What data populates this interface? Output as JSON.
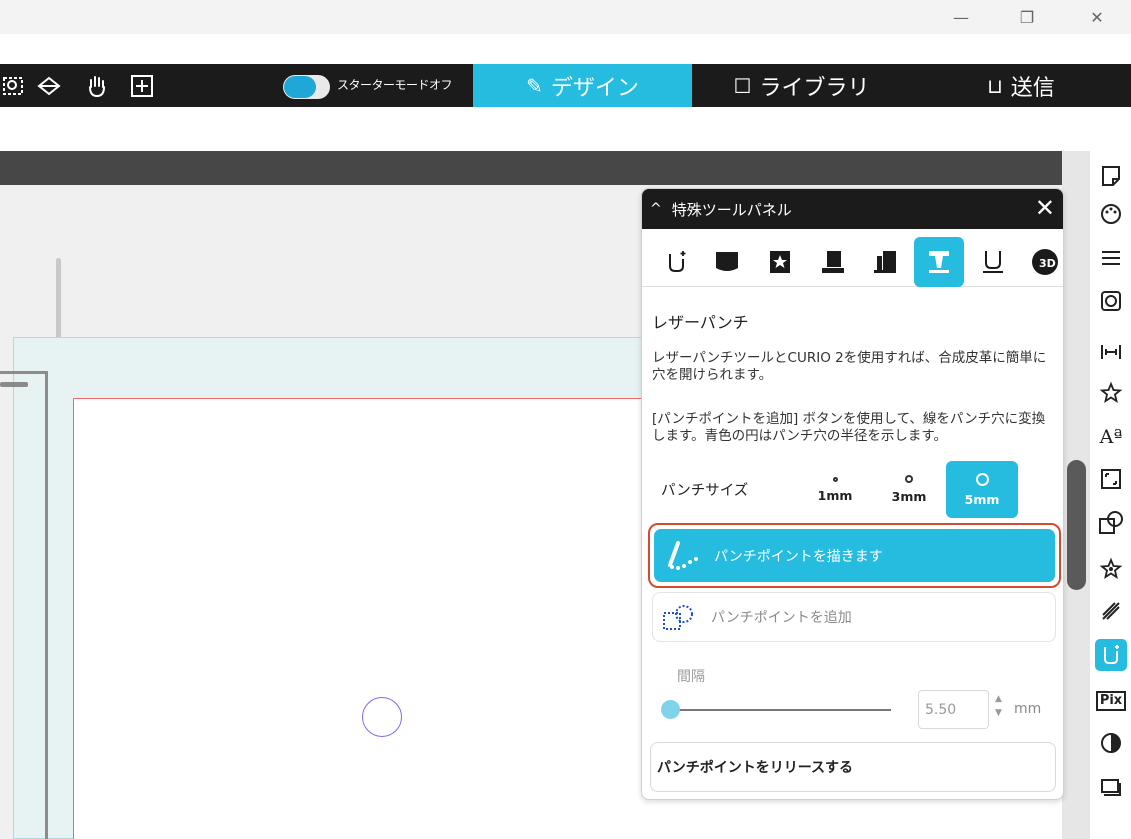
{
  "window_controls": {
    "minimize": "—",
    "restore": "❐",
    "close": "✕"
  },
  "toolbar": {
    "icons": [
      "zoom-selection-icon",
      "view-icon",
      "hand-icon",
      "fit-icon"
    ],
    "starter_mode_label": "スターターモードオフ",
    "tabs": [
      {
        "label": "デザイン",
        "icon": "✎",
        "active": true
      },
      {
        "label": "ライブラリ",
        "icon": "☐",
        "active": false
      },
      {
        "label": "送信",
        "icon": "⊔",
        "active": false
      }
    ]
  },
  "panel": {
    "title": "特殊ツールパネル",
    "collapse_glyph": "^",
    "close_glyph": "✕",
    "section_title": "レザーパンチ",
    "description1": "レザーパンチツールとCURIO 2を使用すれば、合成皮革に簡単に穴を開けられます。",
    "description2": "[パンチポイントを追加] ボタンを使用して、線をパンチ穴に変換します。青色の円はパンチ穴の半径を示します。",
    "punch_size_label": "パンチサイズ",
    "sizes": [
      {
        "label": "1mm",
        "active": false
      },
      {
        "label": "3mm",
        "active": false
      },
      {
        "label": "5mm",
        "active": true
      }
    ],
    "draw_button": "パンチポイントを描きます",
    "add_button": "パンチポイントを追加",
    "interval_label": "間隔",
    "interval_value": "5.50",
    "interval_unit": "mm",
    "interval_slider_value": 0,
    "release_button": "パンチポイントをリリースする"
  },
  "right_toolbar_active": "punch-tool-icon"
}
